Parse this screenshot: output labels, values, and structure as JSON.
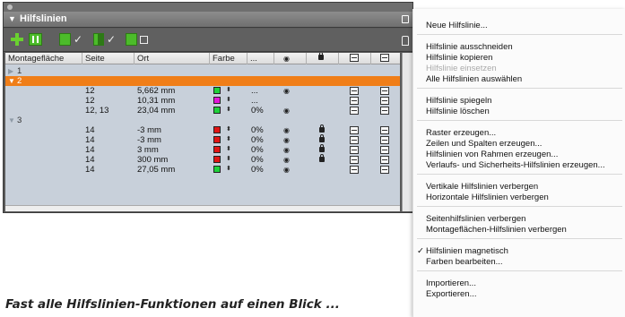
{
  "palette": {
    "title": "Hilfslinien",
    "columns": [
      "Montagefläche",
      "Seite",
      "Ort",
      "Farbe",
      "...",
      "eye-icon",
      "lock-icon",
      "view-icon",
      "snap-icon"
    ],
    "groups": [
      {
        "name": "1",
        "expanded": false,
        "selected": false,
        "rows": []
      },
      {
        "name": "2",
        "expanded": true,
        "selected": true,
        "rows": [
          {
            "seite": "12",
            "ort": "5,662 mm",
            "color": "#1fd13a",
            "pct": "...",
            "visible": true,
            "locked": false
          },
          {
            "seite": "12",
            "ort": "10,31 mm",
            "color": "#e316d8",
            "pct": "...",
            "visible": false,
            "locked": false
          },
          {
            "seite": "12, 13",
            "ort": "23,04 mm",
            "color": "#1fd13a",
            "pct": "0%",
            "visible": true,
            "locked": false
          }
        ]
      },
      {
        "name": "3",
        "expanded": true,
        "selected": false,
        "rows": [
          {
            "seite": "14",
            "ort": "-3 mm",
            "color": "#e01515",
            "pct": "0%",
            "visible": true,
            "locked": true
          },
          {
            "seite": "14",
            "ort": "-3 mm",
            "color": "#e01515",
            "pct": "0%",
            "visible": true,
            "locked": true
          },
          {
            "seite": "14",
            "ort": "3 mm",
            "color": "#e01515",
            "pct": "0%",
            "visible": true,
            "locked": true
          },
          {
            "seite": "14",
            "ort": "300 mm",
            "color": "#e01515",
            "pct": "0%",
            "visible": true,
            "locked": true
          },
          {
            "seite": "14",
            "ort": "27,05 mm",
            "color": "#1fd13a",
            "pct": "0%",
            "visible": true,
            "locked": false
          }
        ]
      }
    ]
  },
  "menu": {
    "sections": [
      [
        {
          "label": "Neue Hilfslinie..."
        }
      ],
      [
        {
          "label": "Hilfslinie ausschneiden"
        },
        {
          "label": "Hilfslinie kopieren"
        },
        {
          "label": "Hilfslinie einsetzen",
          "disabled": true
        },
        {
          "label": "Alle Hilfslinien auswählen"
        }
      ],
      [
        {
          "label": "Hilfslinie spiegeln"
        },
        {
          "label": "Hilfslinie löschen"
        }
      ],
      [
        {
          "label": "Raster erzeugen..."
        },
        {
          "label": "Zeilen und Spalten erzeugen..."
        },
        {
          "label": "Hilfslinien von Rahmen erzeugen..."
        },
        {
          "label": "Verlaufs- und Sicherheits-Hilfslinien erzeugen..."
        }
      ],
      [
        {
          "label": "Vertikale Hilfslinien verbergen"
        },
        {
          "label": "Horizontale Hilfslinien verbergen"
        }
      ],
      [
        {
          "label": "Seitenhilfslinien verbergen"
        },
        {
          "label": "Montageflächen-Hilfslinien verbergen"
        }
      ],
      [
        {
          "label": "Hilfslinien magnetisch",
          "checked": true
        },
        {
          "label": "Farben bearbeiten..."
        }
      ],
      [
        {
          "label": "Importieren..."
        },
        {
          "label": "Exportieren..."
        }
      ]
    ]
  },
  "caption": "Fast alle Hilfslinien-Funktionen auf einen Blick ...",
  "symbols": {
    "check": "✓",
    "collapsed": "▶",
    "expanded": "▼",
    "updown": "⬍",
    "eye": "◉"
  }
}
